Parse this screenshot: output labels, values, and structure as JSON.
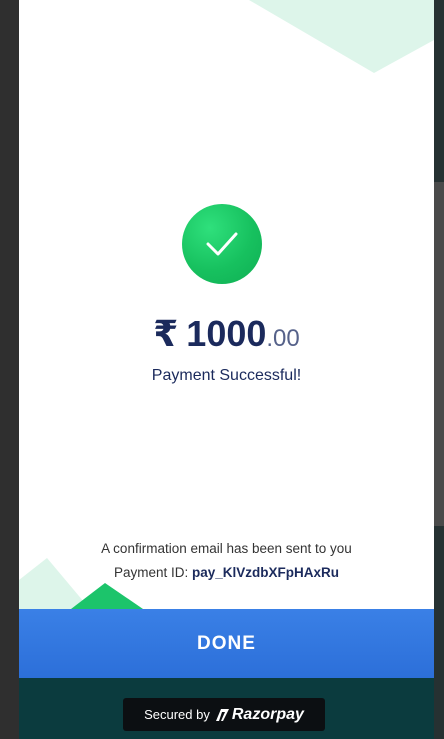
{
  "payment": {
    "currency_symbol": "₹",
    "amount_whole": "1000",
    "amount_fraction": ".00",
    "status": "Payment Successful!",
    "confirmation": "A confirmation email has been sent to you",
    "payment_id_label": "Payment ID:",
    "payment_id_value": "pay_KlVzdbXFpHAxRu"
  },
  "actions": {
    "done_label": "DONE"
  },
  "footer": {
    "secured_by": "Secured by",
    "brand": "Razorpay"
  },
  "icons": {
    "success": "checkmark-icon",
    "brand_logo": "razorpay-logo-icon"
  },
  "colors": {
    "success_green": "#17c15f",
    "button_blue": "#2c6fd9",
    "amount_navy": "#1b2a5c",
    "background_teal": "#0b3b3e",
    "decor_mint": "#ddf5ea"
  }
}
